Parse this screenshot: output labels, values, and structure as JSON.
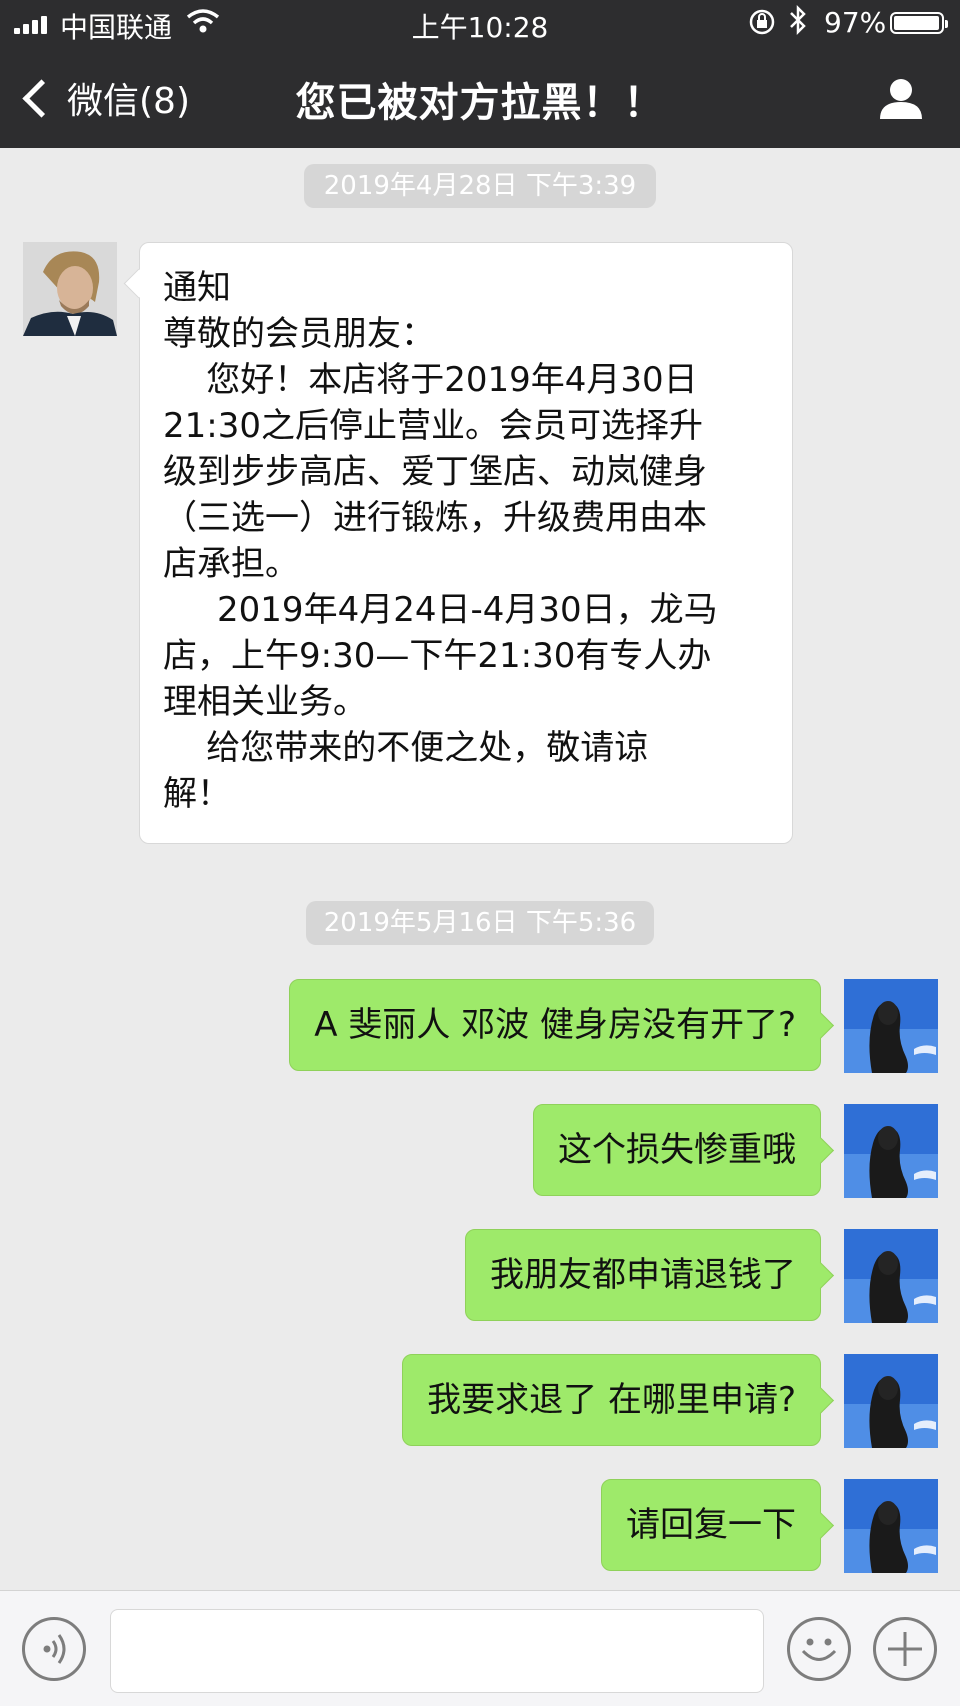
{
  "status_bar": {
    "carrier": "中国联通",
    "time": "上午10:28",
    "battery_text": "97%",
    "battery_level": 0.97
  },
  "nav": {
    "back_label": "微信(8)",
    "title": "您已被对方拉黑！！"
  },
  "messages": {
    "timestamp_1": "2019年4月28日 下午3:39",
    "notice_lines": [
      "通知",
      "尊敬的会员朋友：",
      "    您好！本店将于2019年4月30日",
      "21:30之后停止营业。会员可选择升",
      "级到步步高店、爱丁堡店、动岚健身",
      "（三选一）进行锻炼，升级费用由本",
      "店承担。",
      "     2019年4月24日-4月30日，龙马",
      "店，上午9:30—下午21:30有专人办",
      "理相关业务。",
      "    给您带来的不便之处，敬请谅",
      "解！"
    ],
    "timestamp_2": "2019年5月16日 下午5:36",
    "outgoing": [
      "A 斐丽人  邓波 健身房没有开了?",
      "这个损失惨重哦",
      "我朋友都申请退钱了",
      "我要求退了 在哪里申请?",
      "请回复一下"
    ]
  },
  "input": {
    "value": ""
  },
  "colors": {
    "nav_bg": "#2d2d2f",
    "chat_bg": "#ebebeb",
    "bubble_out": "#9eea6a",
    "bubble_in": "#ffffff"
  }
}
